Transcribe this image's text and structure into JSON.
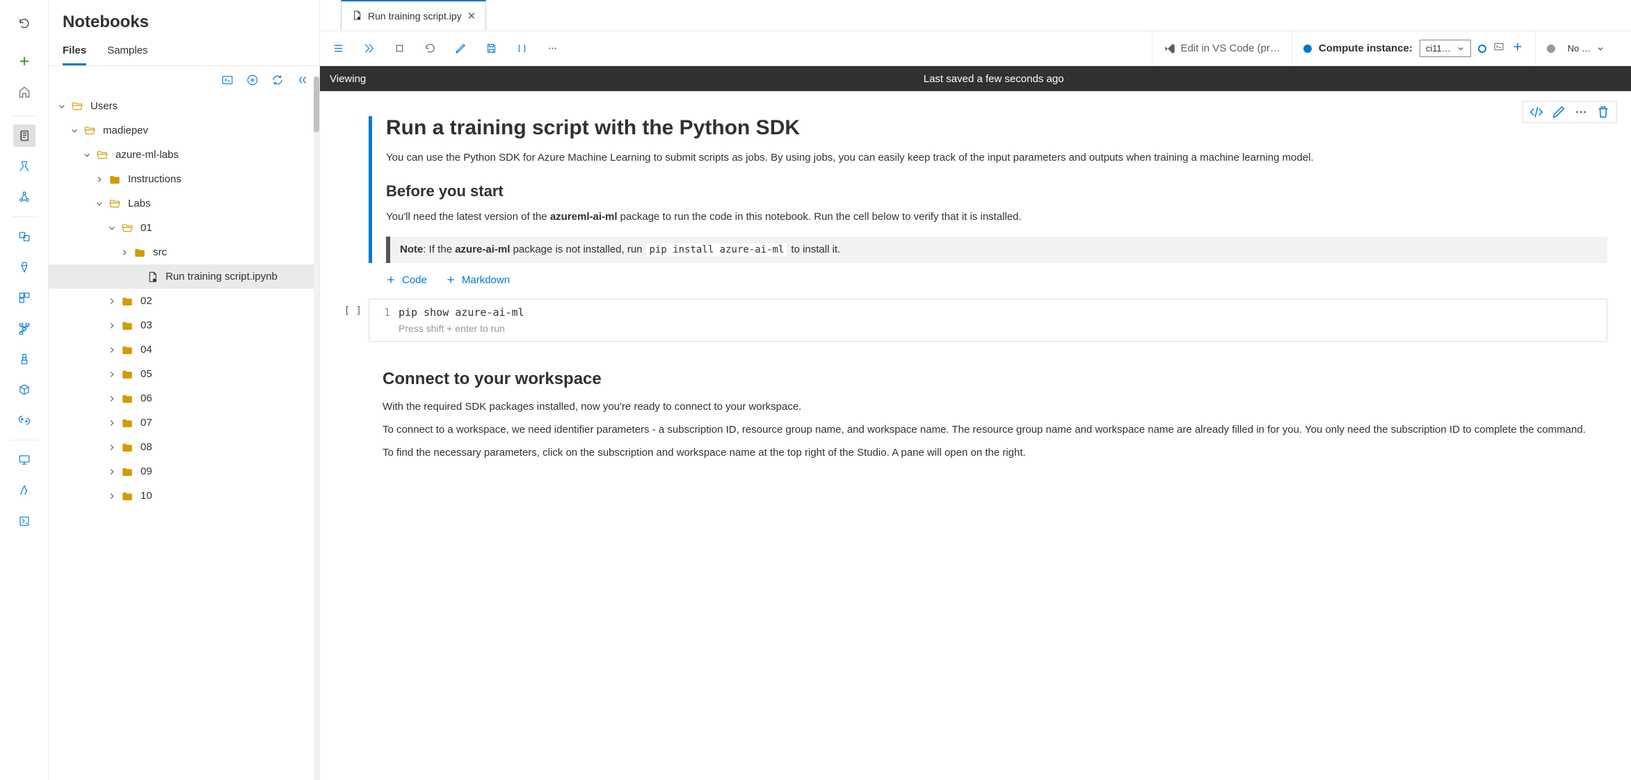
{
  "sidebar": {
    "title": "Notebooks",
    "tabs": {
      "files": "Files",
      "samples": "Samples",
      "active": "files"
    }
  },
  "tree": {
    "users": "Users",
    "user": "madiepev",
    "labs_repo": "azure-ml-labs",
    "instructions": "Instructions",
    "labs": "Labs",
    "l01": "01",
    "src": "src",
    "notebook_file": "Run training script.ipynb",
    "l02": "02",
    "l03": "03",
    "l04": "04",
    "l05": "05",
    "l06": "06",
    "l07": "07",
    "l08": "08",
    "l09": "09",
    "l10": "10"
  },
  "tab": {
    "filename": "Run training script.ipy"
  },
  "toolbar": {
    "vscode": "Edit in VS Code (pr…",
    "compute_label": "Compute instance:",
    "compute_value": "ci11…",
    "kernel_value": "No …"
  },
  "status": {
    "mode": "Viewing",
    "saved": "Last saved a few seconds ago"
  },
  "notebook": {
    "h1": "Run a training script with the Python SDK",
    "p1": "You can use the Python SDK for Azure Machine Learning to submit scripts as jobs. By using jobs, you can easily keep track of the input parameters and outputs when training a machine learning model.",
    "h2a": "Before you start",
    "p2_a": "You'll need the latest version of the ",
    "p2_pkg": "azureml-ai-ml",
    "p2_b": " package to run the code in this notebook. Run the cell below to verify that it is installed.",
    "note_label": "Note",
    "note_a": ": If the ",
    "note_pkg": "azure-ai-ml",
    "note_b": " package is not installed, run ",
    "note_code": "pip install azure-ai-ml",
    "note_c": " to install it.",
    "add_code": "Code",
    "add_md": "Markdown",
    "code1": "pip show azure-ai-ml",
    "code_hint": "Press shift + enter to run",
    "h2b": "Connect to your workspace",
    "p3": "With the required SDK packages installed, now you're ready to connect to your workspace.",
    "p4": "To connect to a workspace, we need identifier parameters - a subscription ID, resource group name, and workspace name. The resource group name and workspace name are already filled in for you. You only need the subscription ID to complete the command.",
    "p5": "To find the necessary parameters, click on the subscription and workspace name at the top right of the Studio. A pane will open on the right."
  }
}
